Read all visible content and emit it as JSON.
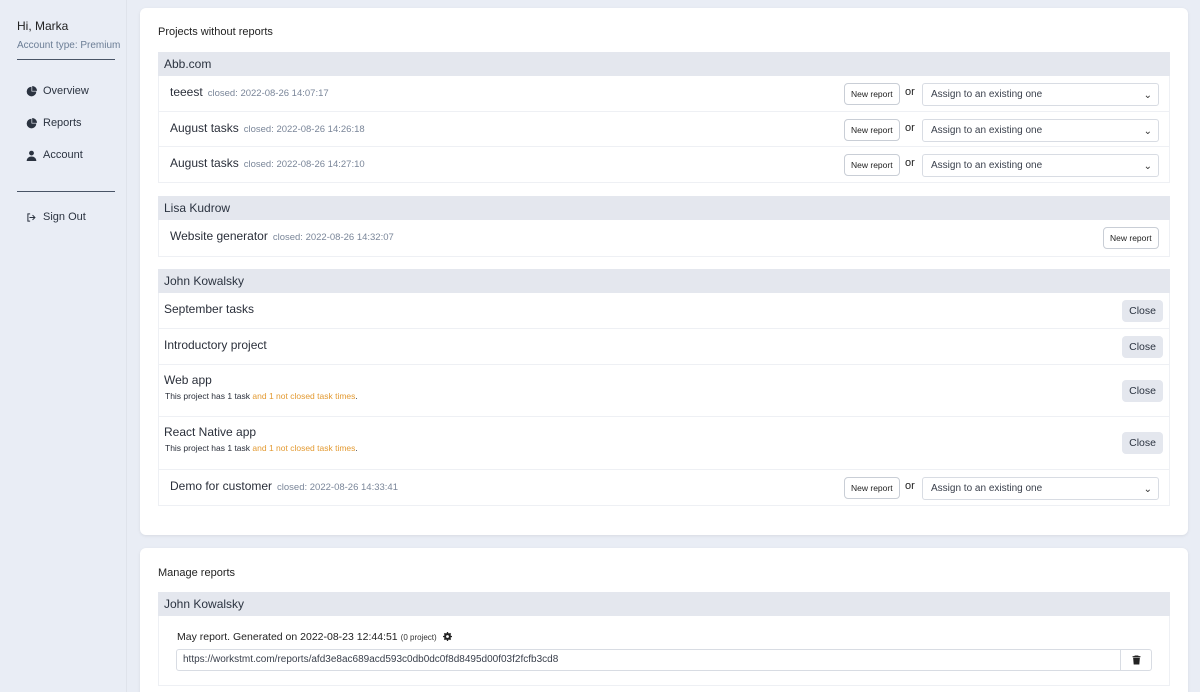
{
  "sidebar": {
    "greeting": "Hi, Marka",
    "account_type": "Account type: Premium",
    "items": [
      {
        "label": "Overview",
        "icon": "pie-chart-icon"
      },
      {
        "label": "Reports",
        "icon": "pie-chart-icon"
      },
      {
        "label": "Account",
        "icon": "user-icon"
      }
    ],
    "sign_out": "Sign Out"
  },
  "projects_without_reports": {
    "title": "Projects without reports",
    "or_label": "or",
    "new_report_label": "New report",
    "assign_placeholder": "Assign to an existing one",
    "close_label": "Close",
    "groups": [
      {
        "name": "Abb.com",
        "rows": [
          {
            "title": "teeest",
            "closed": "closed: 2022-08-26 14:07:17"
          },
          {
            "title": "August tasks",
            "closed": "closed: 2022-08-26 14:26:18"
          },
          {
            "title": "August tasks",
            "closed": "closed: 2022-08-26 14:27:10"
          }
        ]
      },
      {
        "name": "Lisa Kudrow",
        "rows": [
          {
            "title": "Website generator",
            "closed": "closed: 2022-08-26 14:32:07"
          }
        ]
      },
      {
        "name": "John Kowalsky",
        "rows": [
          {
            "title": "September tasks"
          },
          {
            "title": "Introductory project"
          },
          {
            "title": "Web app",
            "sub_prefix": "This project has 1 task ",
            "sub_warn": "and 1 not closed task times",
            "sub_suffix": "."
          },
          {
            "title": "React Native app",
            "sub_prefix": "This project has 1 task ",
            "sub_warn": "and 1 not closed task times",
            "sub_suffix": "."
          },
          {
            "title": "Demo for customer",
            "closed": "closed: 2022-08-26 14:33:41"
          }
        ]
      }
    ]
  },
  "manage_reports": {
    "title": "Manage reports",
    "group_name": "John Kowalsky",
    "report_title": "May report. Generated on 2022-08-23 12:44:51",
    "report_count": "(0 project)",
    "url": "https://workstmt.com/reports/afd3e8ac689acd593c0db0dc0f8d8495d00f03f2fcfb3cd8"
  }
}
